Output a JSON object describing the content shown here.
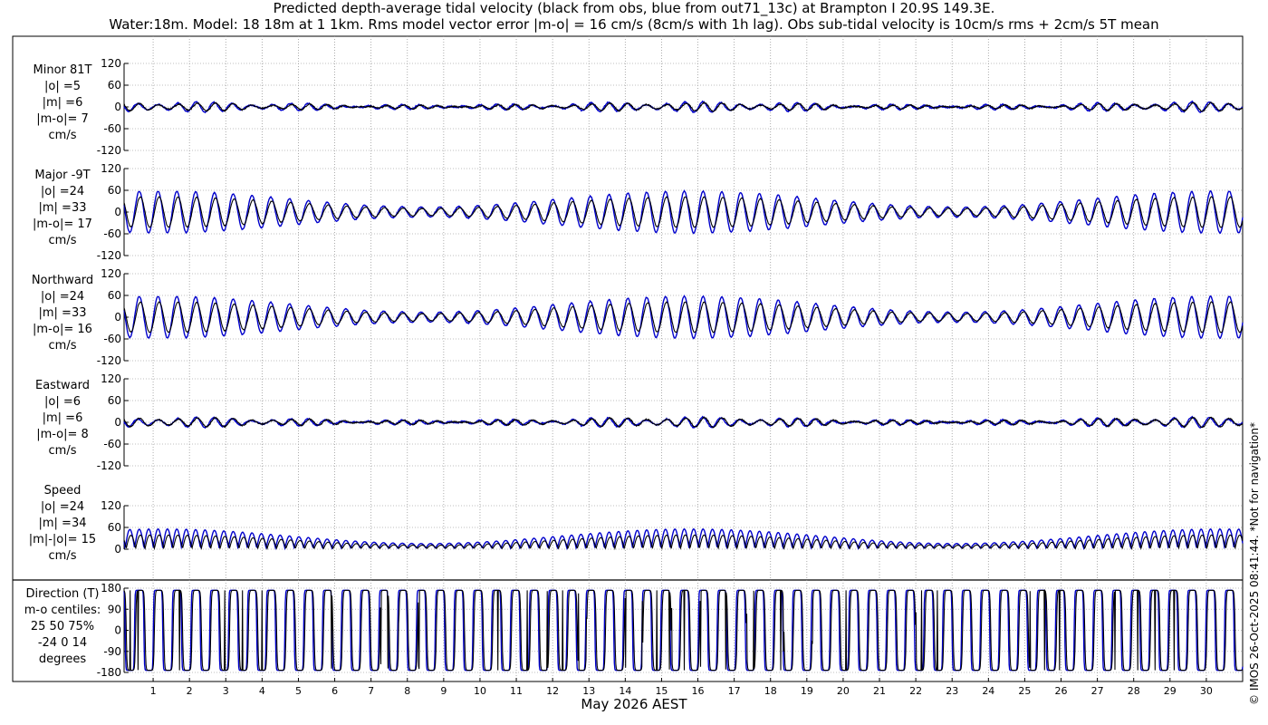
{
  "title_line1": "Predicted depth-average tidal velocity (black from obs, blue from out71_13c) at Brampton I 20.9S 149.3E.",
  "title_line2": "Water:18m. Model: 18 18m at 1 1km. Rms model vector error |m-o| = 16 cm/s (8cm/s with 1h lag). Obs sub-tidal velocity is 10cm/s rms + 2cm/s 5T mean",
  "copyright": "© IMOS 26-Oct-2025 08:41:44. *Not for navigation*",
  "colors": {
    "obs": "#000000",
    "model": "#0000cc"
  },
  "chart_data": {
    "type": "line",
    "xlabel": "May 2026 AEST",
    "x_ticks": [
      1,
      2,
      3,
      4,
      5,
      6,
      7,
      8,
      9,
      10,
      11,
      12,
      13,
      14,
      15,
      16,
      17,
      18,
      19,
      20,
      21,
      22,
      23,
      24,
      25,
      26,
      27,
      28,
      29,
      30
    ],
    "xlim": [
      0.2,
      31
    ],
    "grid": true,
    "series_legend": [
      "obs",
      "model"
    ],
    "panels": [
      {
        "key": "minor",
        "label_lines": [
          "Minor 81T",
          "|o| =5",
          "|m| =6",
          "|m-o|= 7",
          "cm/s"
        ],
        "yticks": [
          "120",
          "60",
          "0",
          "-60",
          "-120"
        ],
        "ylim": [
          -120,
          120
        ],
        "kind": "velocity",
        "obs_amp_cm_s": 5,
        "model_amp_cm_s": 6
      },
      {
        "key": "major",
        "label_lines": [
          "Major -9T",
          "|o| =24",
          "|m| =33",
          "|m-o|= 17",
          "cm/s"
        ],
        "yticks": [
          "120",
          "60",
          "0",
          "-60",
          "-120"
        ],
        "ylim": [
          -120,
          120
        ],
        "kind": "velocity",
        "obs_amp_cm_s": 24,
        "model_amp_cm_s": 33
      },
      {
        "key": "north",
        "label_lines": [
          "Northward",
          "|o| =24",
          "|m| =33",
          "|m-o|= 16",
          "cm/s"
        ],
        "yticks": [
          "120",
          "60",
          "0",
          "-60",
          "-120"
        ],
        "ylim": [
          -120,
          120
        ],
        "kind": "velocity",
        "obs_amp_cm_s": 24,
        "model_amp_cm_s": 33
      },
      {
        "key": "east",
        "label_lines": [
          "Eastward",
          "|o| =6",
          "|m| =6",
          "|m-o|= 8",
          "cm/s"
        ],
        "yticks": [
          "120",
          "60",
          "0",
          "-60",
          "-120"
        ],
        "ylim": [
          -120,
          120
        ],
        "kind": "velocity",
        "obs_amp_cm_s": 6,
        "model_amp_cm_s": 6
      },
      {
        "key": "speed",
        "label_lines": [
          "Speed",
          "|o| =24",
          "|m| =34",
          "|m|-|o|= 15",
          "cm/s"
        ],
        "yticks": [
          "120",
          "60",
          "0"
        ],
        "ylim": [
          0,
          120
        ],
        "kind": "speed",
        "obs_amp_cm_s": 24,
        "model_amp_cm_s": 34
      },
      {
        "key": "direction",
        "label_lines": [
          "Direction (T)",
          "m-o centiles:",
          "25  50  75%",
          "-24   0  14",
          "degrees"
        ],
        "yticks": [
          "180",
          "90",
          "0",
          "-90",
          "-180"
        ],
        "ylim": [
          -180,
          180
        ],
        "kind": "direction"
      }
    ]
  }
}
